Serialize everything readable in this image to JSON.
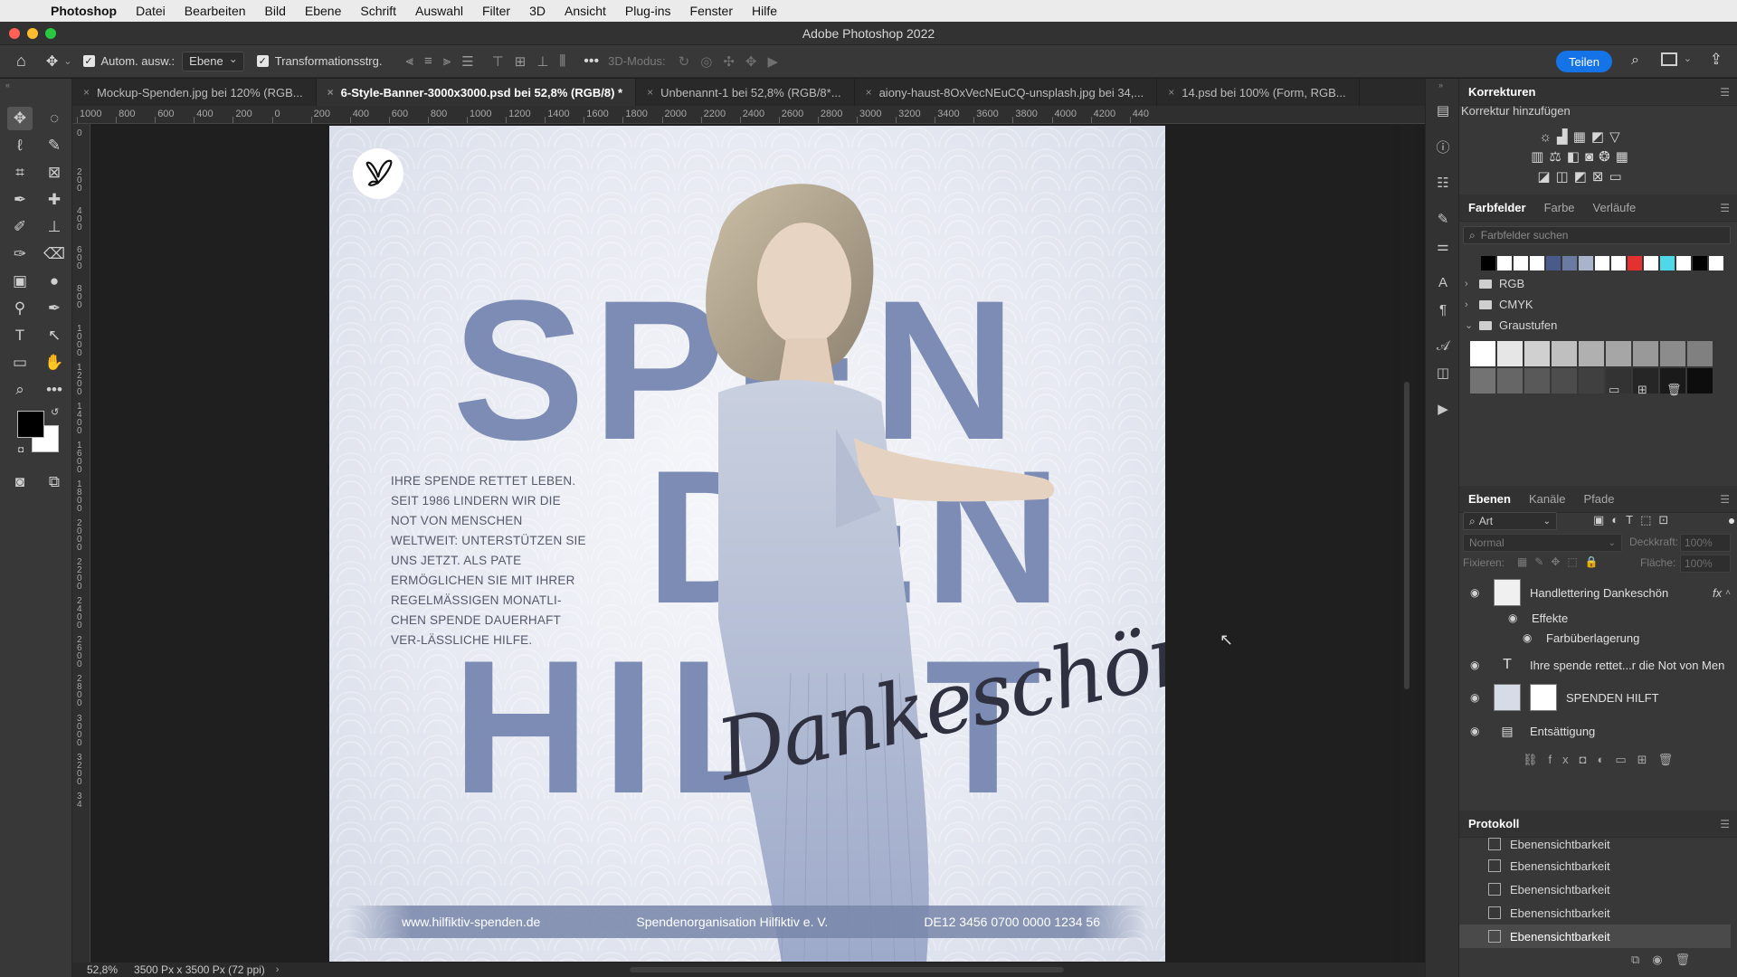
{
  "menubar": {
    "items": [
      "Photoshop",
      "Datei",
      "Bearbeiten",
      "Bild",
      "Ebene",
      "Schrift",
      "Auswahl",
      "Filter",
      "3D",
      "Ansicht",
      "Plug-ins",
      "Fenster",
      "Hilfe"
    ]
  },
  "window": {
    "title": "Adobe Photoshop 2022"
  },
  "options_bar": {
    "auto_select_label": "Autom. ausw.:",
    "auto_select_value": "Ebene",
    "transform_label": "Transformationsstrg.",
    "mode_3d_label": "3D-Modus:",
    "share_label": "Teilen"
  },
  "tabs": [
    {
      "label": "Mockup-Spenden.jpg bei 120% (RGB..."
    },
    {
      "label": "6-Style-Banner-3000x3000.psd bei 52,8% (RGB/8) *"
    },
    {
      "label": "Unbenannt-1 bei 52,8% (RGB/8*..."
    },
    {
      "label": "aiony-haust-8OxVecNEuCQ-unsplash.jpg bei 34,..."
    },
    {
      "label": "14.psd bei 100% (Form, RGB..."
    }
  ],
  "ruler_top_labels": [
    "1000",
    "800",
    "600",
    "400",
    "200",
    "0",
    "200",
    "400",
    "600",
    "800",
    "1000",
    "1200",
    "1400",
    "1600",
    "1800",
    "2000",
    "2200",
    "2400",
    "2600",
    "2800",
    "3000",
    "3200",
    "3400",
    "3600",
    "3800",
    "4000",
    "4200",
    "440"
  ],
  "ruler_left_labels": [
    "0",
    "2 0 0",
    "4 0 0",
    "6 0 0",
    "8 0 0",
    "1 0 0 0",
    "1 2 0 0",
    "1 4 0 0",
    "1 6 0 0",
    "1 8 0 0",
    "2 0 0 0",
    "2 2 0 0",
    "2 4 0 0",
    "2 6 0 0",
    "2 8 0 0",
    "3 0 0 0",
    "3 2 0 0",
    "3 4"
  ],
  "artwork": {
    "letters_row1": "SPEN",
    "letters_row2": "DEN",
    "letters_row3": "HILFT",
    "blurb": "Ihre Spende rettet Leben. Seit 1986 lindern wir die Not von Menschen weltweit: Unterstützen Sie uns jetzt. Als Pate ermöglichen Sie mit Ihrer regelmäßigen monatli-chen Spende dauerhaft ver-lässliche Hilfe.",
    "handlettering": "Dankeschön!",
    "footer_url": "www.hilfiktiv-spenden.de",
    "footer_org": "Spendenorganisation Hilfiktiv e. V.",
    "footer_iban": "DE12 3456 0700 0000 1234 56"
  },
  "status": {
    "zoom": "52,8%",
    "doc_info": "3500 Px x 3500 Px (72 ppi)"
  },
  "korrekturen": {
    "tab": "Korrekturen",
    "subtitle": "Korrektur hinzufügen"
  },
  "farbfelder": {
    "tabs": [
      "Farbfelder",
      "Farbe",
      "Verläufe"
    ],
    "search_placeholder": "Farbfelder suchen",
    "swatches": [
      "#000000",
      "#ffffff",
      "#ffffff",
      "#ffffff",
      "#4a5a8a",
      "#6a7aa0",
      "#a9b3cc",
      "#ffffff",
      "#ffffff",
      "#e53030",
      "#ffffff",
      "#4fd8e8",
      "#ffffff",
      "#000000",
      "#ffffff"
    ],
    "groups": [
      {
        "name": "RGB",
        "open": false
      },
      {
        "name": "CMYK",
        "open": false
      },
      {
        "name": "Graustufen",
        "open": true
      }
    ],
    "gray_row1": [
      "#ffffff",
      "#e6e6e6",
      "#d0d0d0",
      "#bfbfbf",
      "#b0b0b0",
      "#a6a6a6",
      "#999999",
      "#8c8c8c",
      "#808080"
    ],
    "gray_row2": [
      "#737373",
      "#666666",
      "#595959",
      "#4d4d4d",
      "#404040",
      "#333333",
      "#262626",
      "#1a1a1a",
      "#0d0d0d"
    ]
  },
  "ebenen": {
    "tabs": [
      "Ebenen",
      "Kanäle",
      "Pfade"
    ],
    "filter_label": "Art",
    "blend_mode": "Normal",
    "opacity_label": "Deckkraft:",
    "opacity_value": "100%",
    "lock_label": "Fixieren:",
    "fill_label": "Fläche:",
    "fill_value": "100%",
    "layers": [
      {
        "name": "Handlettering Dankeschön",
        "fx": "fx"
      },
      {
        "name": "Effekte"
      },
      {
        "name": "Farbüberlagerung"
      },
      {
        "name": "Ihre spende rettet...r die Not von Men"
      },
      {
        "name": "SPENDEN HILFT"
      },
      {
        "name": "Entsättigung"
      }
    ]
  },
  "protokoll": {
    "tab": "Protokoll",
    "items": [
      "Ebenensichtbarkeit",
      "Ebenensichtbarkeit",
      "Ebenensichtbarkeit",
      "Ebenensichtbarkeit",
      "Ebenensichtbarkeit"
    ]
  },
  "colors": {
    "accent": "#1473e6",
    "letters": "#7d8cb4",
    "panel_bg": "#383838"
  }
}
